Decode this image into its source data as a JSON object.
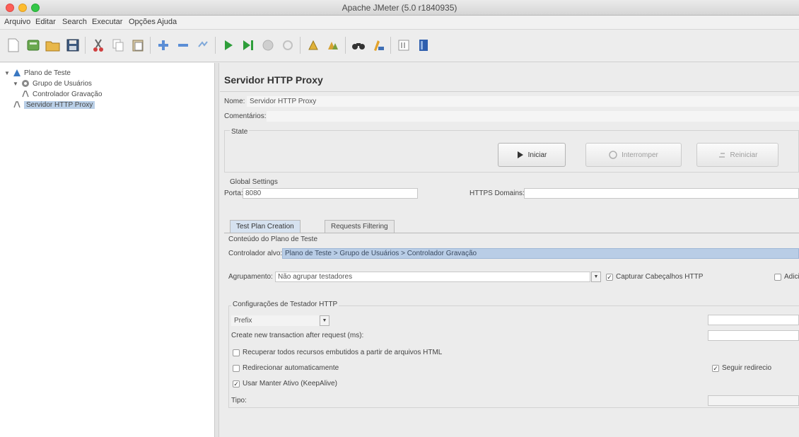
{
  "window": {
    "title": "Apache JMeter (5.0 r1840935)"
  },
  "menu": [
    "Arquivo",
    "Editar",
    "Search",
    "Executar",
    "Opções",
    "Ajuda"
  ],
  "toolbar": {
    "icons": [
      "new-icon",
      "templates-icon",
      "open-icon",
      "save-icon",
      "cut-icon",
      "copy-icon",
      "paste-icon",
      "expand-icon",
      "collapse-icon",
      "toggle-icon",
      "start-icon",
      "start-no-pause-icon",
      "stop-icon",
      "shutdown-icon",
      "clear-icon",
      "clear-all-icon",
      "search-icon",
      "reset-search-icon",
      "function-helper-icon",
      "help-icon"
    ]
  },
  "tree": {
    "nodes": [
      {
        "label": "Plano de Teste"
      },
      {
        "label": "Grupo de Usuários"
      },
      {
        "label": "Controlador Gravação"
      },
      {
        "label": "Servidor HTTP Proxy"
      }
    ]
  },
  "panel": {
    "title": "Servidor HTTP Proxy",
    "name_label": "Nome:",
    "name_value": "Servidor HTTP Proxy",
    "comments_label": "Comentários:",
    "state_label": "State",
    "start_button": "Iniciar",
    "stop_button": "Interromper",
    "restart_button": "Reiniciar",
    "global_settings_label": "Global Settings",
    "port_label": "Porta:",
    "port_value": "8080",
    "https_domains_label": "HTTPS Domains:",
    "https_domains_value": "",
    "tabs": [
      "Test Plan Creation",
      "Requests Filtering"
    ],
    "test_plan_content_label": "Conteúdo do Plano de Teste",
    "target_controller_label": "Controlador alvo:",
    "target_controller_value": "Plano de Teste > Grupo de Usuários > Controlador Gravação",
    "grouping_label": "Agrupamento:",
    "grouping_value": "Não agrupar testadores",
    "capture_headers_label": "Capturar Cabeçalhos HTTP",
    "add_assertions_label": "Adicio",
    "sampler_config_label": "Configurações de Testador HTTP",
    "prefix_value": "Prefix",
    "create_transaction_label": "Create new transaction after request (ms):",
    "retrieve_resources_label": "Recuperar todos recursos embutidos a partir de arquivos HTML",
    "redirect_auto_label": "Redirecionar automaticamente",
    "follow_redirects_label": "Seguir redirecio",
    "keepalive_label": "Usar Manter Ativo (KeepAlive)",
    "type_label": "Tipo:"
  }
}
